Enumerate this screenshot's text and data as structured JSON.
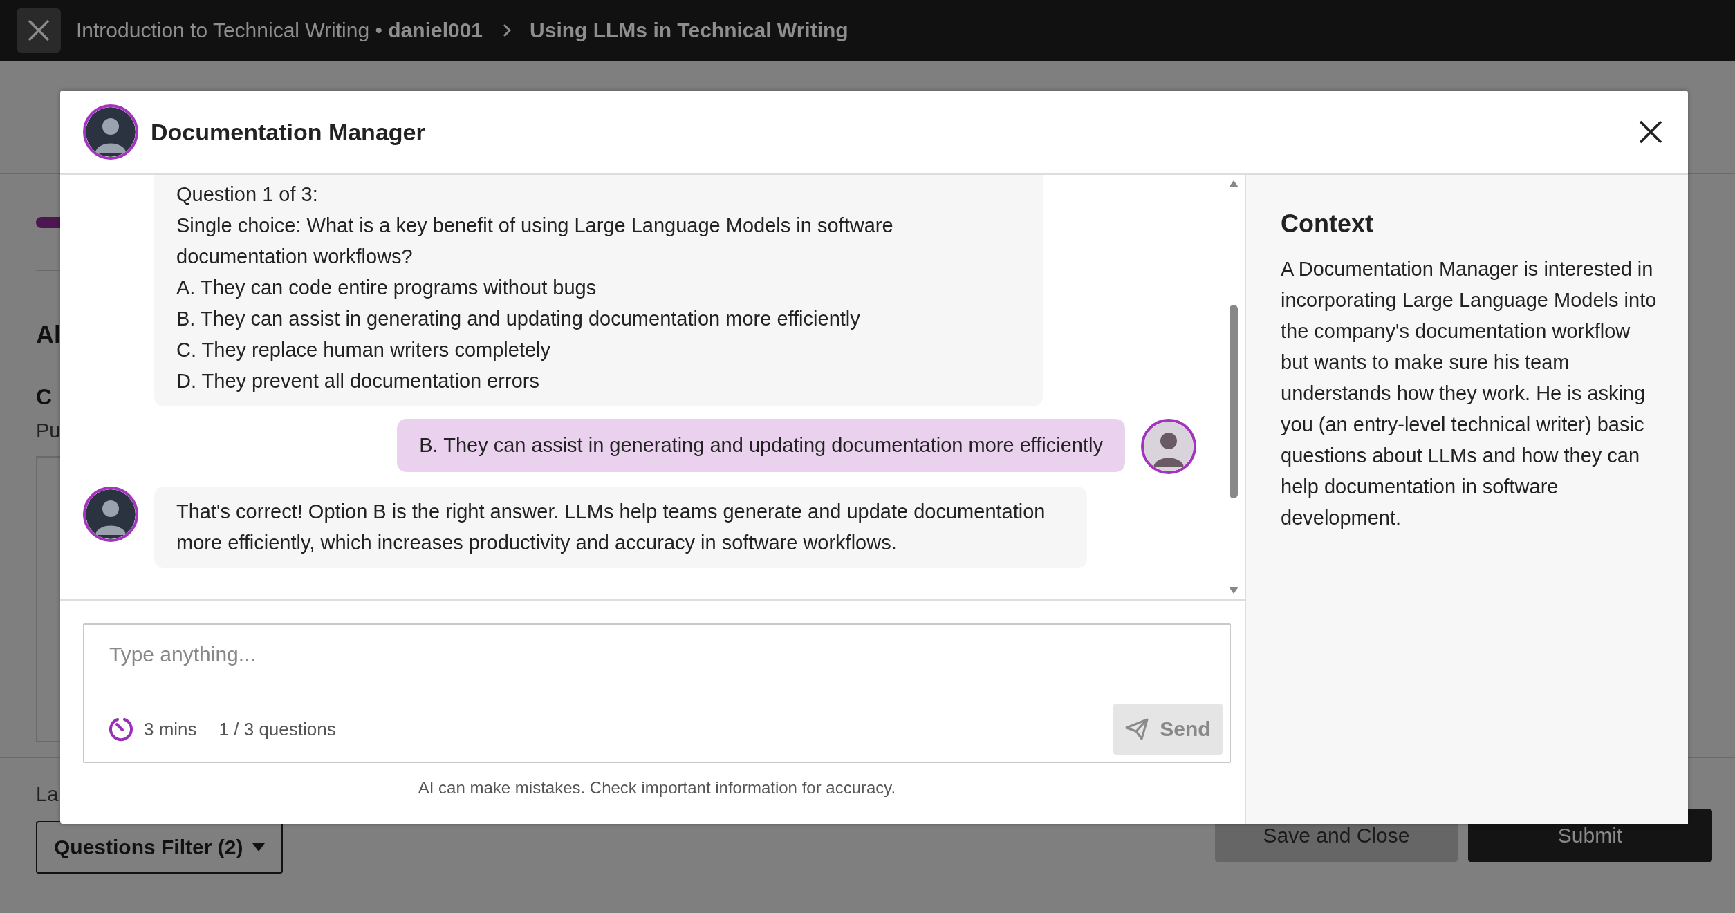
{
  "top_bar": {
    "course": "Introduction to Technical Writing",
    "separator": "•",
    "user": "daniel001",
    "page": "Using LLMs in Technical Writing"
  },
  "background_page": {
    "section_heading": "Al",
    "subheading": "C",
    "subtext": "Pu",
    "footer_label": "La",
    "filter_button": "Questions Filter (2)",
    "save_button": "Save and Close",
    "submit_button": "Submit"
  },
  "dialog": {
    "title": "Documentation Manager",
    "messages": [
      {
        "kind": "bot",
        "avatar": false,
        "lines": [
          "Question 1 of 3:",
          "Single choice: What is a key benefit of using Large Language Models in software documentation workflows?",
          "A. They can code entire programs without bugs",
          "B. They can assist in generating and updating documentation more efficiently",
          "C. They replace human writers completely",
          "D. They prevent all documentation errors"
        ]
      },
      {
        "kind": "user",
        "avatar": true,
        "lines": [
          "B. They can assist in generating and updating documentation more efficiently"
        ]
      },
      {
        "kind": "bot",
        "avatar": true,
        "lines": [
          "That's correct! Option B is the right answer. LLMs help teams generate and update documentation more efficiently, which increases productivity and accuracy in software workflows."
        ]
      }
    ],
    "composer": {
      "placeholder": "Type anything...",
      "timer": "3 mins",
      "progress": "1 / 3 questions",
      "send_label": "Send"
    },
    "disclaimer": "AI can make mistakes. Check important information for accuracy.",
    "context": {
      "heading": "Context",
      "body": "A Documentation Manager is interested in incorporating Large Language Models into the company's documentation workflow but wants to make sure his team understands how they work. He is asking you (an entry-level technical writer) basic questions about LLMs and how they can help documentation in software development."
    }
  }
}
